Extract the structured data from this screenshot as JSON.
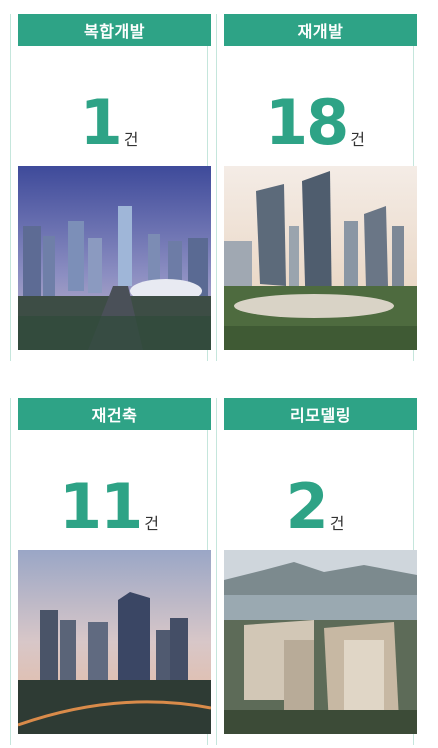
{
  "cards": [
    {
      "title": "복합개발",
      "count": "1",
      "unit": "건",
      "image": "mixed-use-development-rendering"
    },
    {
      "title": "재개발",
      "count": "18",
      "unit": "건",
      "image": "redevelopment-towers-rendering"
    },
    {
      "title": "재건축",
      "count": "11",
      "unit": "건",
      "image": "reconstruction-apartments-rendering"
    },
    {
      "title": "리모델링",
      "count": "2",
      "unit": "건",
      "image": "remodeling-apartments-rendering"
    }
  ],
  "colors": {
    "accent": "#2ea386",
    "border": "#c5e6dc",
    "unit_text": "#333333"
  }
}
